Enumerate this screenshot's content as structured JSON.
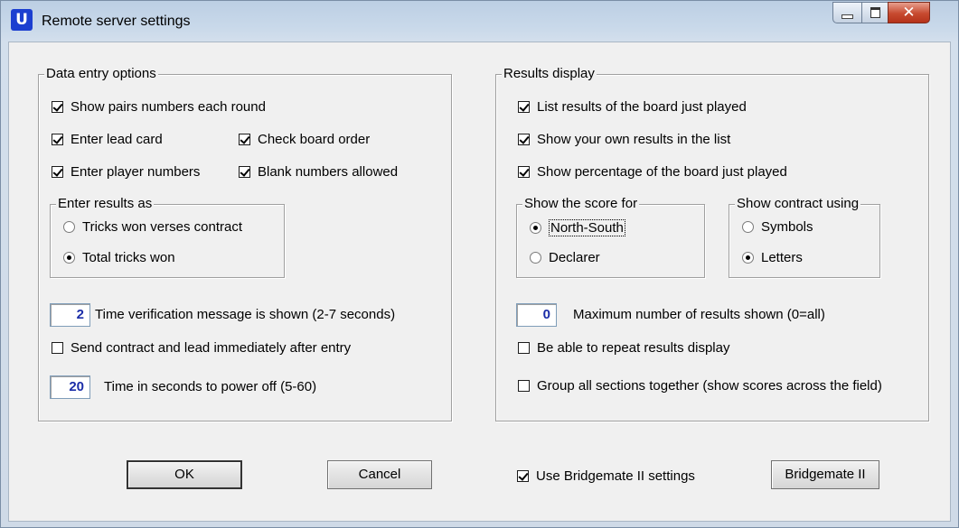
{
  "window": {
    "title": "Remote server settings",
    "app_icon": "U"
  },
  "data_entry": {
    "title": "Data entry options",
    "show_pairs": {
      "label": "Show pairs numbers each round",
      "checked": true
    },
    "enter_lead": {
      "label": "Enter lead card",
      "checked": true
    },
    "check_board": {
      "label": "Check board order",
      "checked": true
    },
    "enter_player": {
      "label": "Enter player numbers",
      "checked": true
    },
    "blank_numbers": {
      "label": "Blank numbers allowed",
      "checked": true
    },
    "enter_results": {
      "title": "Enter results as",
      "tricks_vs": {
        "label": "Tricks won verses contract",
        "selected": false
      },
      "total_tricks": {
        "label": "Total tricks won",
        "selected": true
      }
    },
    "time_verification": {
      "value": "2",
      "label": "Time verification message is shown (2-7 seconds)"
    },
    "send_contract": {
      "label": "Send contract and lead immediately after entry",
      "checked": false
    },
    "power_off": {
      "value": "20",
      "label": "Time in seconds to power off (5-60)"
    }
  },
  "results_display": {
    "title": "Results display",
    "list_results": {
      "label": "List results of the board just played",
      "checked": true
    },
    "show_own": {
      "label": "Show your own results in the list",
      "checked": true
    },
    "show_percentage": {
      "label": "Show percentage of the board just played",
      "checked": true
    },
    "score_for": {
      "title": "Show the score for",
      "north_south": {
        "label": "North-South",
        "selected": true
      },
      "declarer": {
        "label": "Declarer",
        "selected": false
      }
    },
    "contract_using": {
      "title": "Show contract using",
      "symbols": {
        "label": "Symbols",
        "selected": false
      },
      "letters": {
        "label": "Letters",
        "selected": true
      }
    },
    "max_results": {
      "value": "0",
      "label": "Maximum number of results shown (0=all)"
    },
    "repeat_display": {
      "label": "Be able to repeat results display",
      "checked": false
    },
    "group_sections": {
      "label": "Group all sections together (show scores across the field)",
      "checked": false
    }
  },
  "footer": {
    "ok": "OK",
    "cancel": "Cancel",
    "use_bm2": {
      "label": "Use Bridgemate II settings",
      "checked": true
    },
    "bm2_button": "Bridgemate II"
  }
}
